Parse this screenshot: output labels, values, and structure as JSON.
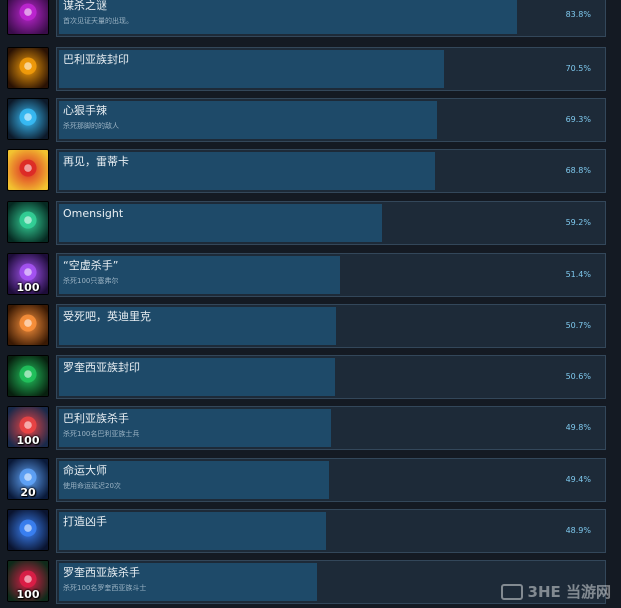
{
  "achievements": [
    {
      "title": "谋杀之谜",
      "desc": "首次见证天量的出现。",
      "percent": "83.8%",
      "fraction": 0.838,
      "badge": "",
      "icon": "purple-figure-icon",
      "c1": "#3a0d4a",
      "c2": "#c026d3"
    },
    {
      "title": "巴利亚族封印",
      "desc": "",
      "percent": "70.5%",
      "fraction": 0.705,
      "badge": "",
      "icon": "fire-orb-icon",
      "c1": "#2a1204",
      "c2": "#f59e0b"
    },
    {
      "title": "心狠手辣",
      "desc": "杀死那脚的的敌人",
      "percent": "69.3%",
      "fraction": 0.693,
      "badge": "",
      "icon": "warrior-icon",
      "c1": "#0d1a2a",
      "c2": "#38bdf8"
    },
    {
      "title": "再见，雷蒂卡",
      "desc": "",
      "percent": "68.8%",
      "fraction": 0.688,
      "badge": "",
      "icon": "red-figure-icon",
      "c1": "#f2c230",
      "c2": "#dc2626"
    },
    {
      "title": "Omensight",
      "desc": "",
      "percent": "59.2%",
      "fraction": 0.592,
      "badge": "",
      "icon": "green-orb-icon",
      "c1": "#062a22",
      "c2": "#34d399"
    },
    {
      "title": "“空虚杀手”",
      "desc": "杀死100只塞弗尔",
      "percent": "51.4%",
      "fraction": 0.514,
      "badge": "100",
      "icon": "void-creature-icon",
      "c1": "#1e0d3a",
      "c2": "#a855f7"
    },
    {
      "title": "受死吧，英迪里克",
      "desc": "",
      "percent": "50.7%",
      "fraction": 0.507,
      "badge": "",
      "icon": "flame-warrior-icon",
      "c1": "#3a1a04",
      "c2": "#fb923c"
    },
    {
      "title": "罗奎西亚族封印",
      "desc": "",
      "percent": "50.6%",
      "fraction": 0.506,
      "badge": "",
      "icon": "green-seal-icon",
      "c1": "#08200f",
      "c2": "#22c55e"
    },
    {
      "title": "巴利亚族杀手",
      "desc": "杀死100名巴利亚族士兵",
      "percent": "49.8%",
      "fraction": 0.498,
      "badge": "100",
      "icon": "soldier-icon",
      "c1": "#1a2a4a",
      "c2": "#ef4444"
    },
    {
      "title": "命运大师",
      "desc": "使用命运延迟20次",
      "percent": "49.4%",
      "fraction": 0.494,
      "badge": "20",
      "icon": "clock-icon",
      "c1": "#0a1a3a",
      "c2": "#60a5fa"
    },
    {
      "title": "打造凶手",
      "desc": "",
      "percent": "48.9%",
      "fraction": 0.489,
      "badge": "",
      "icon": "blue-swirl-icon",
      "c1": "#0a1430",
      "c2": "#3b82f6"
    },
    {
      "title": "罗奎西亚族杀手",
      "desc": "杀死100名罗奎西亚族斗士",
      "percent": "",
      "fraction": 0.472,
      "badge": "100",
      "icon": "green-soldier-icon",
      "c1": "#0f2a1a",
      "c2": "#e11d48"
    }
  ],
  "watermark": "3HE 当游网"
}
